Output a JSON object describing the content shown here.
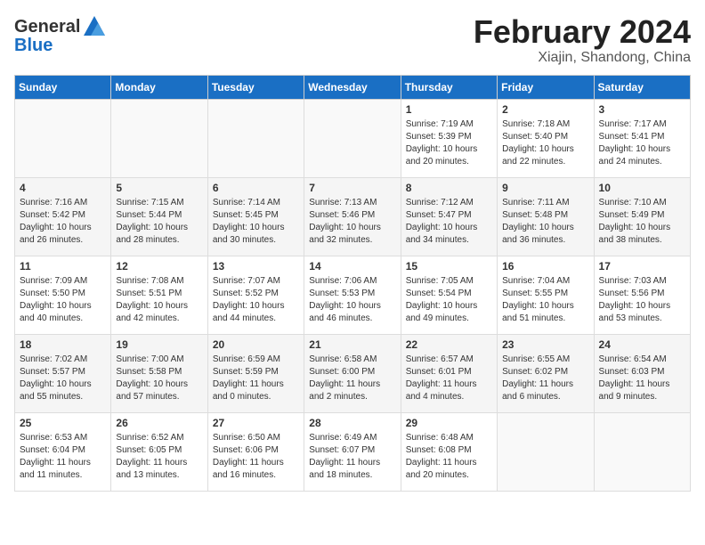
{
  "header": {
    "logo_general": "General",
    "logo_blue": "Blue",
    "title": "February 2024",
    "subtitle": "Xiajin, Shandong, China"
  },
  "weekdays": [
    "Sunday",
    "Monday",
    "Tuesday",
    "Wednesday",
    "Thursday",
    "Friday",
    "Saturday"
  ],
  "weeks": [
    [
      {
        "day": "",
        "info": ""
      },
      {
        "day": "",
        "info": ""
      },
      {
        "day": "",
        "info": ""
      },
      {
        "day": "",
        "info": ""
      },
      {
        "day": "1",
        "info": "Sunrise: 7:19 AM\nSunset: 5:39 PM\nDaylight: 10 hours\nand 20 minutes."
      },
      {
        "day": "2",
        "info": "Sunrise: 7:18 AM\nSunset: 5:40 PM\nDaylight: 10 hours\nand 22 minutes."
      },
      {
        "day": "3",
        "info": "Sunrise: 7:17 AM\nSunset: 5:41 PM\nDaylight: 10 hours\nand 24 minutes."
      }
    ],
    [
      {
        "day": "4",
        "info": "Sunrise: 7:16 AM\nSunset: 5:42 PM\nDaylight: 10 hours\nand 26 minutes."
      },
      {
        "day": "5",
        "info": "Sunrise: 7:15 AM\nSunset: 5:44 PM\nDaylight: 10 hours\nand 28 minutes."
      },
      {
        "day": "6",
        "info": "Sunrise: 7:14 AM\nSunset: 5:45 PM\nDaylight: 10 hours\nand 30 minutes."
      },
      {
        "day": "7",
        "info": "Sunrise: 7:13 AM\nSunset: 5:46 PM\nDaylight: 10 hours\nand 32 minutes."
      },
      {
        "day": "8",
        "info": "Sunrise: 7:12 AM\nSunset: 5:47 PM\nDaylight: 10 hours\nand 34 minutes."
      },
      {
        "day": "9",
        "info": "Sunrise: 7:11 AM\nSunset: 5:48 PM\nDaylight: 10 hours\nand 36 minutes."
      },
      {
        "day": "10",
        "info": "Sunrise: 7:10 AM\nSunset: 5:49 PM\nDaylight: 10 hours\nand 38 minutes."
      }
    ],
    [
      {
        "day": "11",
        "info": "Sunrise: 7:09 AM\nSunset: 5:50 PM\nDaylight: 10 hours\nand 40 minutes."
      },
      {
        "day": "12",
        "info": "Sunrise: 7:08 AM\nSunset: 5:51 PM\nDaylight: 10 hours\nand 42 minutes."
      },
      {
        "day": "13",
        "info": "Sunrise: 7:07 AM\nSunset: 5:52 PM\nDaylight: 10 hours\nand 44 minutes."
      },
      {
        "day": "14",
        "info": "Sunrise: 7:06 AM\nSunset: 5:53 PM\nDaylight: 10 hours\nand 46 minutes."
      },
      {
        "day": "15",
        "info": "Sunrise: 7:05 AM\nSunset: 5:54 PM\nDaylight: 10 hours\nand 49 minutes."
      },
      {
        "day": "16",
        "info": "Sunrise: 7:04 AM\nSunset: 5:55 PM\nDaylight: 10 hours\nand 51 minutes."
      },
      {
        "day": "17",
        "info": "Sunrise: 7:03 AM\nSunset: 5:56 PM\nDaylight: 10 hours\nand 53 minutes."
      }
    ],
    [
      {
        "day": "18",
        "info": "Sunrise: 7:02 AM\nSunset: 5:57 PM\nDaylight: 10 hours\nand 55 minutes."
      },
      {
        "day": "19",
        "info": "Sunrise: 7:00 AM\nSunset: 5:58 PM\nDaylight: 10 hours\nand 57 minutes."
      },
      {
        "day": "20",
        "info": "Sunrise: 6:59 AM\nSunset: 5:59 PM\nDaylight: 11 hours\nand 0 minutes."
      },
      {
        "day": "21",
        "info": "Sunrise: 6:58 AM\nSunset: 6:00 PM\nDaylight: 11 hours\nand 2 minutes."
      },
      {
        "day": "22",
        "info": "Sunrise: 6:57 AM\nSunset: 6:01 PM\nDaylight: 11 hours\nand 4 minutes."
      },
      {
        "day": "23",
        "info": "Sunrise: 6:55 AM\nSunset: 6:02 PM\nDaylight: 11 hours\nand 6 minutes."
      },
      {
        "day": "24",
        "info": "Sunrise: 6:54 AM\nSunset: 6:03 PM\nDaylight: 11 hours\nand 9 minutes."
      }
    ],
    [
      {
        "day": "25",
        "info": "Sunrise: 6:53 AM\nSunset: 6:04 PM\nDaylight: 11 hours\nand 11 minutes."
      },
      {
        "day": "26",
        "info": "Sunrise: 6:52 AM\nSunset: 6:05 PM\nDaylight: 11 hours\nand 13 minutes."
      },
      {
        "day": "27",
        "info": "Sunrise: 6:50 AM\nSunset: 6:06 PM\nDaylight: 11 hours\nand 16 minutes."
      },
      {
        "day": "28",
        "info": "Sunrise: 6:49 AM\nSunset: 6:07 PM\nDaylight: 11 hours\nand 18 minutes."
      },
      {
        "day": "29",
        "info": "Sunrise: 6:48 AM\nSunset: 6:08 PM\nDaylight: 11 hours\nand 20 minutes."
      },
      {
        "day": "",
        "info": ""
      },
      {
        "day": "",
        "info": ""
      }
    ]
  ]
}
